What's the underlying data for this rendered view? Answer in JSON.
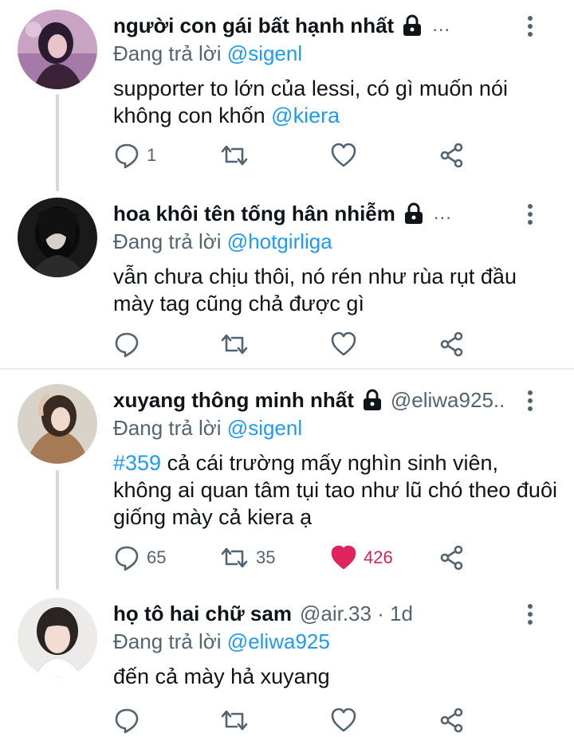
{
  "colors": {
    "accent": "#1d9bf0",
    "liked": "#e0245e",
    "muted": "#536471"
  },
  "tweets": [
    {
      "name": "người con gái bất hạnh nhất",
      "handle": "",
      "overflow": "...",
      "reply_label": "Đang trả lời",
      "reply_mention": "@sigenl",
      "text_before": "supporter to lớn của lessi, có gì muốn nói không con khốn ",
      "text_mention": "@kiera",
      "reply_count": "1",
      "retweet_count": "",
      "like_count": "",
      "liked": false,
      "locked": true
    },
    {
      "name": "hoa khôi tên tống hân nhiễm",
      "handle": "",
      "overflow": "...",
      "reply_label": "Đang trả lời",
      "reply_mention": "@hotgirliga",
      "text_before": "vẫn chưa chịu thôi, nó rén như rùa rụt đầu mày tag cũng chả được gì",
      "text_mention": "",
      "reply_count": "",
      "retweet_count": "",
      "like_count": "",
      "liked": false,
      "locked": true
    },
    {
      "name": "xuyang thông minh nhất",
      "handle": "@eliwa925..",
      "overflow": "",
      "reply_label": "Đang trả lời",
      "reply_mention": "@sigenl",
      "hashtag": "#359",
      "text_before": " cả cái trường mấy nghìn sinh viên, không ai quan tâm tụi tao như lũ chó theo đuôi giống mày cả kiera ạ",
      "text_mention": "",
      "reply_count": "65",
      "retweet_count": "35",
      "like_count": "426",
      "liked": true,
      "locked": true
    },
    {
      "name": "họ tô hai chữ sam",
      "handle": "@air.33 · 1d",
      "overflow": "",
      "reply_label": "Đang trả lời",
      "reply_mention": "@eliwa925",
      "text_before": "đến cả mày hả xuyang",
      "text_mention": "",
      "reply_count": "",
      "retweet_count": "",
      "like_count": "",
      "liked": false,
      "locked": false
    }
  ]
}
